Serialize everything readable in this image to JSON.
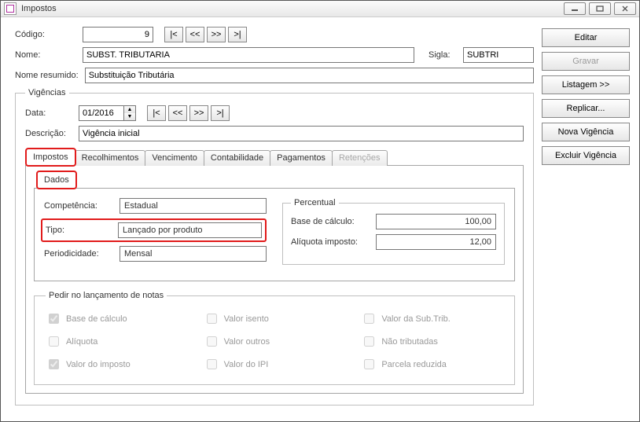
{
  "window": {
    "title": "Impostos"
  },
  "side_buttons": {
    "editar": "Editar",
    "gravar": "Gravar",
    "listagem": "Listagem >>",
    "replicar": "Replicar...",
    "nova_vigencia": "Nova Vigência",
    "excluir_vigencia": "Excluir Vigência"
  },
  "header": {
    "codigo_label": "Código:",
    "codigo_value": "9",
    "nome_label": "Nome:",
    "nome_value": "SUBST. TRIBUTARIA",
    "sigla_label": "Sigla:",
    "sigla_value": "SUBTRI",
    "nome_resumido_label": "Nome resumido:",
    "nome_resumido_value": "Substituição Tributária",
    "nav": {
      "first": "|<",
      "prev": "<<",
      "next": ">>",
      "last": ">|"
    }
  },
  "vigencias": {
    "legend": "Vigências",
    "data_label": "Data:",
    "data_value": "01/2016",
    "descricao_label": "Descrição:",
    "descricao_value": "Vigência inicial",
    "nav": {
      "first": "|<",
      "prev": "<<",
      "next": ">>",
      "last": ">|"
    }
  },
  "tabs": {
    "impostos": "Impostos",
    "recolhimentos": "Recolhimentos",
    "vencimento": "Vencimento",
    "contabilidade": "Contabilidade",
    "pagamentos": "Pagamentos",
    "retencoes": "Retenções"
  },
  "subtab": {
    "dados": "Dados"
  },
  "dados": {
    "competencia_label": "Competência:",
    "competencia_value": "Estadual",
    "tipo_label": "Tipo:",
    "tipo_value": "Lançado por produto",
    "periodicidade_label": "Periodicidade:",
    "periodicidade_value": "Mensal"
  },
  "percentual": {
    "legend": "Percentual",
    "base_label": "Base de cálculo:",
    "base_value": "100,00",
    "aliquota_label": "Alíquota imposto:",
    "aliquota_value": "12,00"
  },
  "req_notas": {
    "legend": "Pedir no lançamento de notas",
    "base_calculo": "Base de cálculo",
    "aliquota": "Alíquota",
    "valor_imposto": "Valor do imposto",
    "valor_isento": "Valor isento",
    "valor_outros": "Valor outros",
    "valor_ipi": "Valor do IPI",
    "valor_subtrib": "Valor da Sub.Trib.",
    "nao_tributadas": "Não tributadas",
    "parcela_reduzida": "Parcela reduzida"
  }
}
